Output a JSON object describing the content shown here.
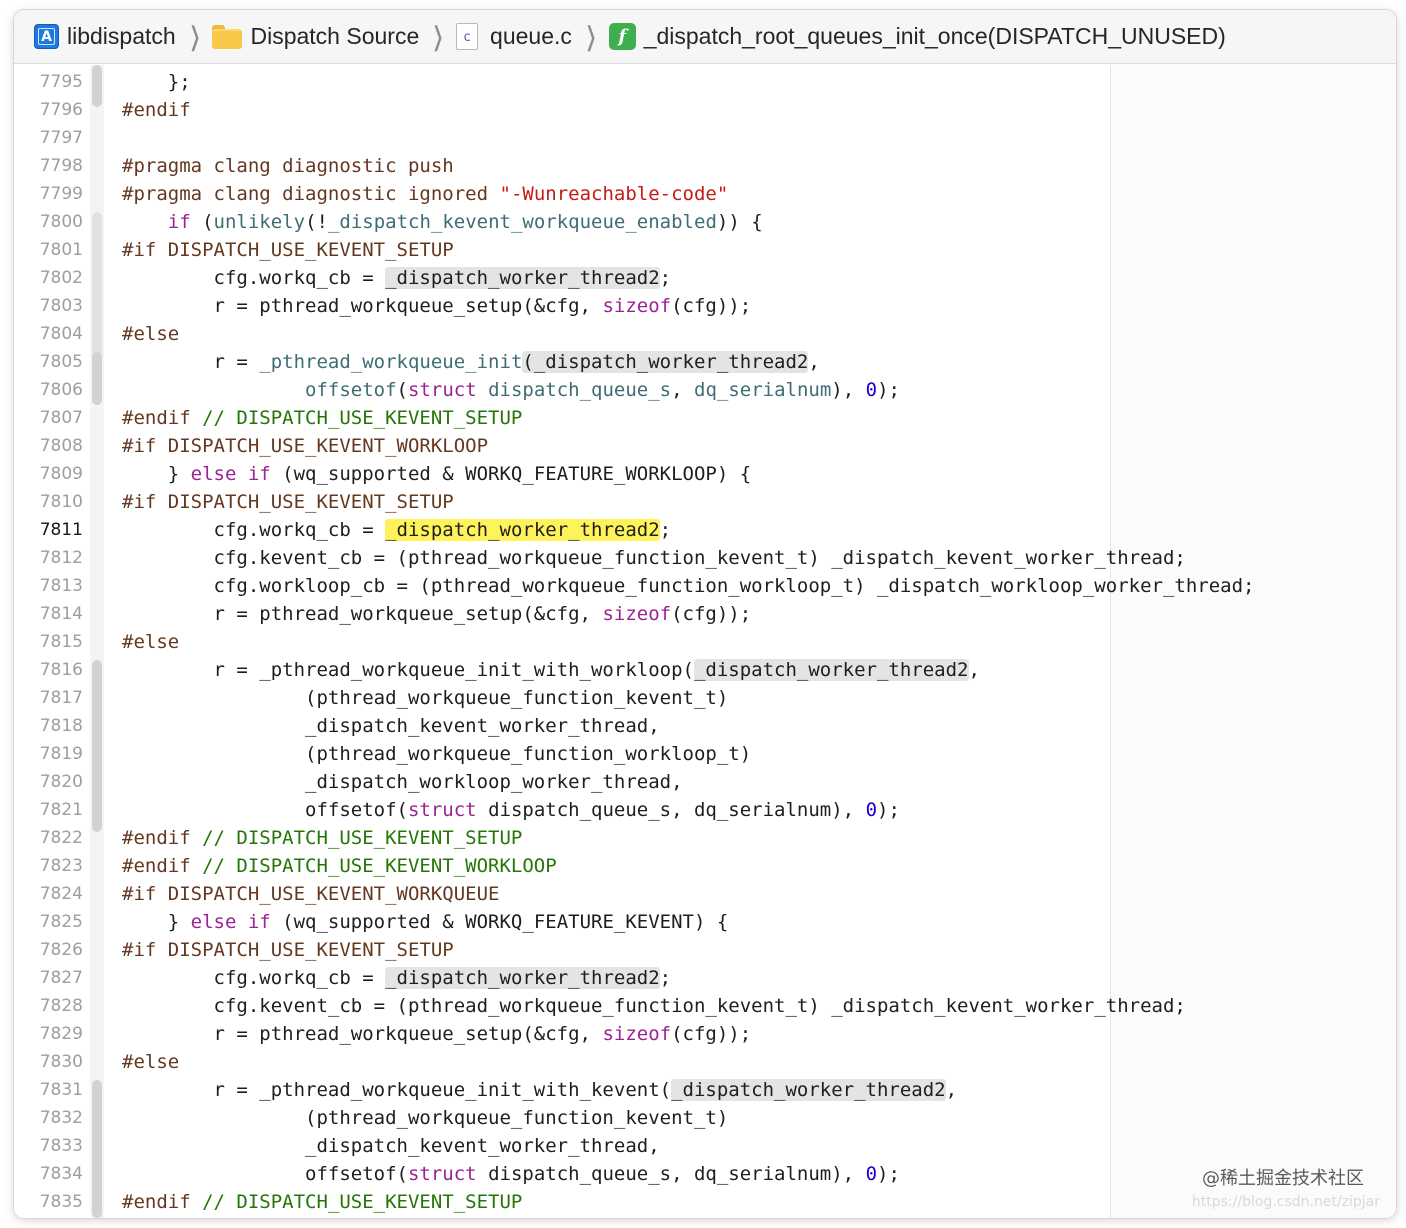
{
  "breadcrumb": {
    "project": "libdispatch",
    "folder": "Dispatch Source",
    "file": "queue.c",
    "file_badge": "c",
    "function": "_dispatch_root_queues_init_once(DISPATCH_UNUSED)",
    "function_badge": "f"
  },
  "editor": {
    "current_line": "7811",
    "lines": [
      {
        "n": "7795",
        "t": [
          [
            "",
            "    };"
          ]
        ]
      },
      {
        "n": "7796",
        "t": [
          [
            "pp",
            "#endif"
          ]
        ]
      },
      {
        "n": "7797",
        "t": []
      },
      {
        "n": "7798",
        "t": [
          [
            "pp",
            "#pragma clang diagnostic push"
          ]
        ]
      },
      {
        "n": "7799",
        "t": [
          [
            "pp",
            "#pragma clang diagnostic ignored "
          ],
          [
            "str",
            "\"-Wunreachable-code\""
          ]
        ]
      },
      {
        "n": "7800",
        "t": [
          [
            "",
            "    "
          ],
          [
            "kw",
            "if"
          ],
          [
            "",
            " ("
          ],
          [
            "pfx",
            "unlikely"
          ],
          [
            "",
            "(!"
          ],
          [
            "pfx",
            "_dispatch_kevent_workqueue_enabled"
          ],
          [
            "",
            "))"
          ],
          [
            "",
            " {"
          ]
        ]
      },
      {
        "n": "7801",
        "t": [
          [
            "pp",
            "#if DISPATCH_USE_KEVENT_SETUP"
          ]
        ]
      },
      {
        "n": "7802",
        "t": [
          [
            "",
            "        cfg.workq_cb = "
          ],
          [
            "hl",
            "_dispatch_worker_thread2"
          ],
          [
            "",
            ";"
          ]
        ]
      },
      {
        "n": "7803",
        "t": [
          [
            "",
            "        r = pthread_workqueue_setup(&cfg, "
          ],
          [
            "kw",
            "sizeof"
          ],
          [
            "",
            "(cfg));"
          ]
        ]
      },
      {
        "n": "7804",
        "t": [
          [
            "pp",
            "#else"
          ]
        ]
      },
      {
        "n": "7805",
        "t": [
          [
            "",
            "        r = "
          ],
          [
            "pfx",
            "_pthread_workqueue_init"
          ],
          [
            "hl",
            "(_dispatch_worker_thread2"
          ],
          [
            "",
            ","
          ]
        ]
      },
      {
        "n": "7806",
        "t": [
          [
            "",
            "                "
          ],
          [
            "pfx",
            "offsetof"
          ],
          [
            "",
            "("
          ],
          [
            "kw",
            "struct"
          ],
          [
            "",
            " "
          ],
          [
            "pfx",
            "dispatch_queue_s"
          ],
          [
            "",
            ", "
          ],
          [
            "pfx",
            "dq_serialnum"
          ],
          [
            "",
            "), "
          ],
          [
            "num",
            "0"
          ],
          [
            "",
            ");"
          ]
        ]
      },
      {
        "n": "7807",
        "t": [
          [
            "pp",
            "#endif "
          ],
          [
            "cmt",
            "// DISPATCH_USE_KEVENT_SETUP"
          ]
        ]
      },
      {
        "n": "7808",
        "t": [
          [
            "pp",
            "#if DISPATCH_USE_KEVENT_WORKLOOP"
          ]
        ]
      },
      {
        "n": "7809",
        "t": [
          [
            "",
            "    } "
          ],
          [
            "kw",
            "else if"
          ],
          [
            "",
            " (wq_supported & WORKQ_FEATURE_WORKLOOP) {"
          ]
        ]
      },
      {
        "n": "7810",
        "t": [
          [
            "pp",
            "#if DISPATCH_USE_KEVENT_SETUP"
          ]
        ]
      },
      {
        "n": "7811",
        "t": [
          [
            "",
            "        cfg.workq_cb = "
          ],
          [
            "hlcur",
            "_dispatch_worker_thread2"
          ],
          [
            "",
            ";"
          ]
        ]
      },
      {
        "n": "7812",
        "t": [
          [
            "",
            "        cfg.kevent_cb = (pthread_workqueue_function_kevent_t) _dispatch_kevent_worker_thread;"
          ]
        ]
      },
      {
        "n": "7813",
        "t": [
          [
            "",
            "        cfg.workloop_cb = (pthread_workqueue_function_workloop_t) _dispatch_workloop_worker_thread;"
          ]
        ]
      },
      {
        "n": "7814",
        "t": [
          [
            "",
            "        r = pthread_workqueue_setup(&cfg, "
          ],
          [
            "kw",
            "sizeof"
          ],
          [
            "",
            "(cfg));"
          ]
        ]
      },
      {
        "n": "7815",
        "t": [
          [
            "pp",
            "#else"
          ]
        ]
      },
      {
        "n": "7816",
        "t": [
          [
            "",
            "        r = _pthread_workqueue_init_with_workloop("
          ],
          [
            "hl",
            "_dispatch_worker_thread2"
          ],
          [
            "",
            ","
          ]
        ]
      },
      {
        "n": "7817",
        "t": [
          [
            "",
            "                (pthread_workqueue_function_kevent_t)"
          ]
        ]
      },
      {
        "n": "7818",
        "t": [
          [
            "",
            "                _dispatch_kevent_worker_thread,"
          ]
        ]
      },
      {
        "n": "7819",
        "t": [
          [
            "",
            "                (pthread_workqueue_function_workloop_t)"
          ]
        ]
      },
      {
        "n": "7820",
        "t": [
          [
            "",
            "                _dispatch_workloop_worker_thread,"
          ]
        ]
      },
      {
        "n": "7821",
        "t": [
          [
            "",
            "                offsetof("
          ],
          [
            "kw",
            "struct"
          ],
          [
            "",
            " dispatch_queue_s, dq_serialnum), "
          ],
          [
            "num",
            "0"
          ],
          [
            "",
            ");"
          ]
        ]
      },
      {
        "n": "7822",
        "t": [
          [
            "pp",
            "#endif "
          ],
          [
            "cmt",
            "// DISPATCH_USE_KEVENT_SETUP"
          ]
        ]
      },
      {
        "n": "7823",
        "t": [
          [
            "pp",
            "#endif "
          ],
          [
            "cmt",
            "// DISPATCH_USE_KEVENT_WORKLOOP"
          ]
        ]
      },
      {
        "n": "7824",
        "t": [
          [
            "pp",
            "#if DISPATCH_USE_KEVENT_WORKQUEUE"
          ]
        ]
      },
      {
        "n": "7825",
        "t": [
          [
            "",
            "    } "
          ],
          [
            "kw",
            "else if"
          ],
          [
            "",
            " (wq_supported & WORKQ_FEATURE_KEVENT) {"
          ]
        ]
      },
      {
        "n": "7826",
        "t": [
          [
            "pp",
            "#if DISPATCH_USE_KEVENT_SETUP"
          ]
        ]
      },
      {
        "n": "7827",
        "t": [
          [
            "",
            "        cfg.workq_cb = "
          ],
          [
            "hl",
            "_dispatch_worker_thread2"
          ],
          [
            "",
            ";"
          ]
        ]
      },
      {
        "n": "7828",
        "t": [
          [
            "",
            "        cfg.kevent_cb = (pthread_workqueue_function_kevent_t) _dispatch_kevent_worker_thread;"
          ]
        ]
      },
      {
        "n": "7829",
        "t": [
          [
            "",
            "        r = pthread_workqueue_setup(&cfg, "
          ],
          [
            "kw",
            "sizeof"
          ],
          [
            "",
            "(cfg));"
          ]
        ]
      },
      {
        "n": "7830",
        "t": [
          [
            "pp",
            "#else"
          ]
        ]
      },
      {
        "n": "7831",
        "t": [
          [
            "",
            "        r = _pthread_workqueue_init_with_kevent("
          ],
          [
            "hl",
            "_dispatch_worker_thread2"
          ],
          [
            "",
            ","
          ]
        ]
      },
      {
        "n": "7832",
        "t": [
          [
            "",
            "                (pthread_workqueue_function_kevent_t)"
          ]
        ]
      },
      {
        "n": "7833",
        "t": [
          [
            "",
            "                _dispatch_kevent_worker_thread,"
          ]
        ]
      },
      {
        "n": "7834",
        "t": [
          [
            "",
            "                offsetof("
          ],
          [
            "kw",
            "struct"
          ],
          [
            "",
            " dispatch_queue_s, dq_serialnum), "
          ],
          [
            "num",
            "0"
          ],
          [
            "",
            ");"
          ]
        ]
      },
      {
        "n": "7835",
        "t": [
          [
            "pp",
            "#endif "
          ],
          [
            "cmt",
            "// DISPATCH_USE_KEVENT_SETUP"
          ]
        ]
      }
    ]
  },
  "watermark": "@稀土掘金技术社区",
  "watermark_url": "https://blog.csdn.net/zipjar",
  "colors": {
    "preprocessor": "#643820",
    "string": "#c41a16",
    "keyword": "#9b2393",
    "comment": "#267507",
    "number": "#1c00cf",
    "current_highlight": "#fff35b",
    "symbol_highlight": "#e4e4e4"
  }
}
